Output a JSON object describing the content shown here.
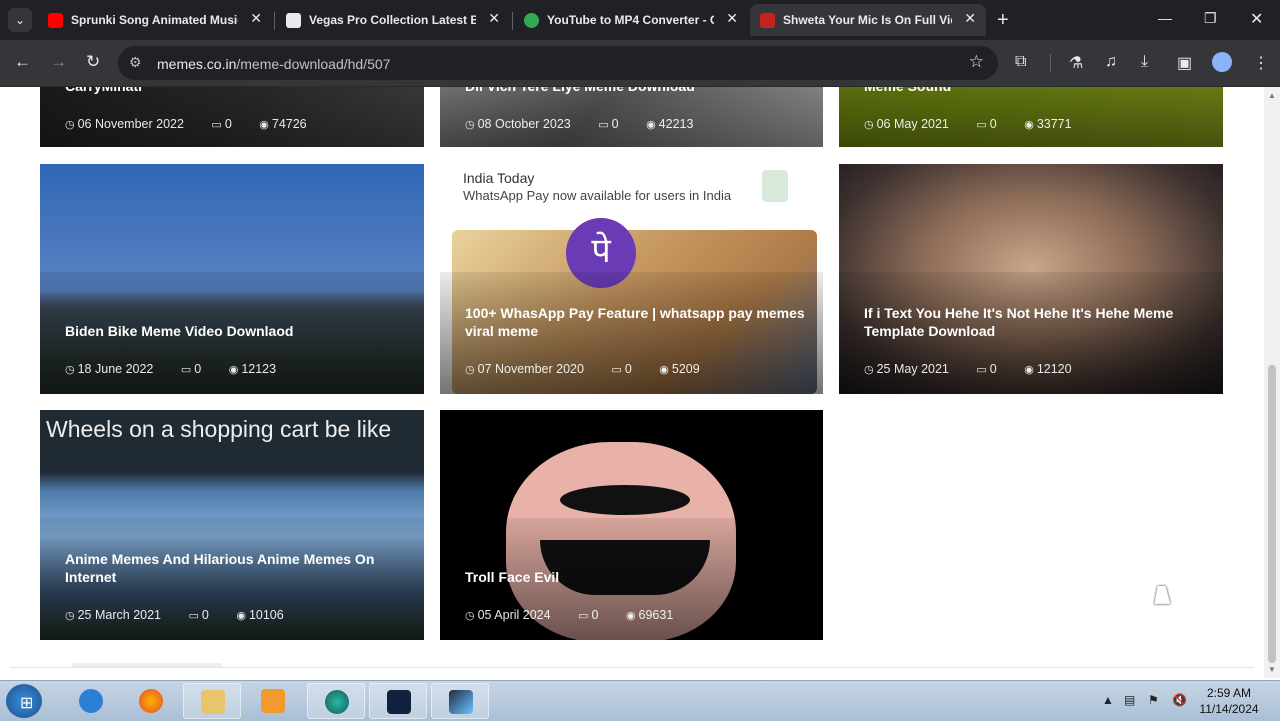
{
  "browser": {
    "tabs": [
      {
        "title": "Sprunki Song Animated Music",
        "favicon": "youtube-icon",
        "active": false
      },
      {
        "title": "Vegas Pro Collection Latest Bu",
        "favicon": "archive-icon",
        "active": false
      },
      {
        "title": "YouTube to MP4 Converter - C",
        "favicon": "converter-icon",
        "active": false
      },
      {
        "title": "Shweta Your Mic Is On Full Vid",
        "favicon": "memes-site-icon",
        "active": true
      }
    ],
    "url_host": "memes.co.in",
    "url_path": "/meme-download/hd/507"
  },
  "cards": [
    {
      "title": "CarryMinati",
      "date": "06 November 2022",
      "comments": "0",
      "views": "74726"
    },
    {
      "title": "Dil Vich Tere Liye Meme Download",
      "date": "08 October 2023",
      "comments": "0",
      "views": "42213"
    },
    {
      "title": "Meme Sound",
      "date": "06 May 2021",
      "comments": "0",
      "views": "33771"
    },
    {
      "title": "Biden Bike Meme Video Downlaod",
      "date": "18 June 2022",
      "comments": "0",
      "views": "12123"
    },
    {
      "title": "100+ WhasApp Pay Feature | whatsapp pay memes viral meme",
      "date": "07 November 2020",
      "comments": "0",
      "views": "5209",
      "image_text": {
        "headline": "India Today",
        "subtitle": "WhatsApp Pay now available for users in India"
      }
    },
    {
      "title": "If i Text You Hehe It's Not Hehe It's Hehe Meme Template Download",
      "date": "25 May 2021",
      "comments": "0",
      "views": "12120"
    },
    {
      "title": "Anime Memes And Hilarious Anime Memes On Internet",
      "date": "25 March 2021",
      "comments": "0",
      "views": "10106",
      "image_text": {
        "caption": "Wheels on a shopping cart be like"
      }
    },
    {
      "title": "Troll Face Evil",
      "date": "05 April 2024",
      "comments": "0",
      "views": "69631"
    }
  ],
  "taskbar": {
    "time": "2:59 AM",
    "date": "11/14/2024"
  }
}
